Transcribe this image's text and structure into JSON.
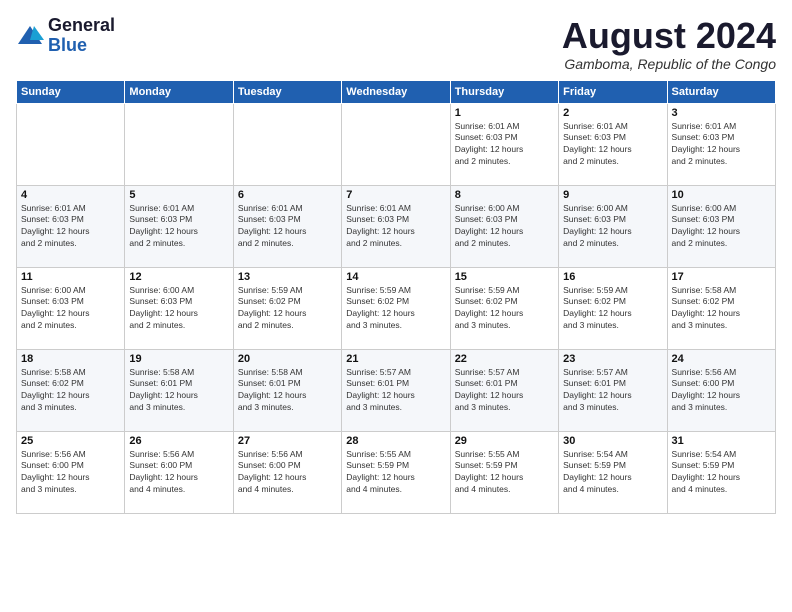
{
  "logo": {
    "general": "General",
    "blue": "Blue"
  },
  "header": {
    "month": "August 2024",
    "location": "Gamboma, Republic of the Congo"
  },
  "weekdays": [
    "Sunday",
    "Monday",
    "Tuesday",
    "Wednesday",
    "Thursday",
    "Friday",
    "Saturday"
  ],
  "weeks": [
    [
      {
        "day": "",
        "sunrise": "",
        "sunset": "",
        "daylight": ""
      },
      {
        "day": "",
        "sunrise": "",
        "sunset": "",
        "daylight": ""
      },
      {
        "day": "",
        "sunrise": "",
        "sunset": "",
        "daylight": ""
      },
      {
        "day": "",
        "sunrise": "",
        "sunset": "",
        "daylight": ""
      },
      {
        "day": "1",
        "sunrise": "6:01 AM",
        "sunset": "6:03 PM",
        "daylight": "12 hours and 2 minutes."
      },
      {
        "day": "2",
        "sunrise": "6:01 AM",
        "sunset": "6:03 PM",
        "daylight": "12 hours and 2 minutes."
      },
      {
        "day": "3",
        "sunrise": "6:01 AM",
        "sunset": "6:03 PM",
        "daylight": "12 hours and 2 minutes."
      }
    ],
    [
      {
        "day": "4",
        "sunrise": "6:01 AM",
        "sunset": "6:03 PM",
        "daylight": "12 hours and 2 minutes."
      },
      {
        "day": "5",
        "sunrise": "6:01 AM",
        "sunset": "6:03 PM",
        "daylight": "12 hours and 2 minutes."
      },
      {
        "day": "6",
        "sunrise": "6:01 AM",
        "sunset": "6:03 PM",
        "daylight": "12 hours and 2 minutes."
      },
      {
        "day": "7",
        "sunrise": "6:01 AM",
        "sunset": "6:03 PM",
        "daylight": "12 hours and 2 minutes."
      },
      {
        "day": "8",
        "sunrise": "6:00 AM",
        "sunset": "6:03 PM",
        "daylight": "12 hours and 2 minutes."
      },
      {
        "day": "9",
        "sunrise": "6:00 AM",
        "sunset": "6:03 PM",
        "daylight": "12 hours and 2 minutes."
      },
      {
        "day": "10",
        "sunrise": "6:00 AM",
        "sunset": "6:03 PM",
        "daylight": "12 hours and 2 minutes."
      }
    ],
    [
      {
        "day": "11",
        "sunrise": "6:00 AM",
        "sunset": "6:03 PM",
        "daylight": "12 hours and 2 minutes."
      },
      {
        "day": "12",
        "sunrise": "6:00 AM",
        "sunset": "6:03 PM",
        "daylight": "12 hours and 2 minutes."
      },
      {
        "day": "13",
        "sunrise": "5:59 AM",
        "sunset": "6:02 PM",
        "daylight": "12 hours and 2 minutes."
      },
      {
        "day": "14",
        "sunrise": "5:59 AM",
        "sunset": "6:02 PM",
        "daylight": "12 hours and 3 minutes."
      },
      {
        "day": "15",
        "sunrise": "5:59 AM",
        "sunset": "6:02 PM",
        "daylight": "12 hours and 3 minutes."
      },
      {
        "day": "16",
        "sunrise": "5:59 AM",
        "sunset": "6:02 PM",
        "daylight": "12 hours and 3 minutes."
      },
      {
        "day": "17",
        "sunrise": "5:58 AM",
        "sunset": "6:02 PM",
        "daylight": "12 hours and 3 minutes."
      }
    ],
    [
      {
        "day": "18",
        "sunrise": "5:58 AM",
        "sunset": "6:02 PM",
        "daylight": "12 hours and 3 minutes."
      },
      {
        "day": "19",
        "sunrise": "5:58 AM",
        "sunset": "6:01 PM",
        "daylight": "12 hours and 3 minutes."
      },
      {
        "day": "20",
        "sunrise": "5:58 AM",
        "sunset": "6:01 PM",
        "daylight": "12 hours and 3 minutes."
      },
      {
        "day": "21",
        "sunrise": "5:57 AM",
        "sunset": "6:01 PM",
        "daylight": "12 hours and 3 minutes."
      },
      {
        "day": "22",
        "sunrise": "5:57 AM",
        "sunset": "6:01 PM",
        "daylight": "12 hours and 3 minutes."
      },
      {
        "day": "23",
        "sunrise": "5:57 AM",
        "sunset": "6:01 PM",
        "daylight": "12 hours and 3 minutes."
      },
      {
        "day": "24",
        "sunrise": "5:56 AM",
        "sunset": "6:00 PM",
        "daylight": "12 hours and 3 minutes."
      }
    ],
    [
      {
        "day": "25",
        "sunrise": "5:56 AM",
        "sunset": "6:00 PM",
        "daylight": "12 hours and 3 minutes."
      },
      {
        "day": "26",
        "sunrise": "5:56 AM",
        "sunset": "6:00 PM",
        "daylight": "12 hours and 4 minutes."
      },
      {
        "day": "27",
        "sunrise": "5:56 AM",
        "sunset": "6:00 PM",
        "daylight": "12 hours and 4 minutes."
      },
      {
        "day": "28",
        "sunrise": "5:55 AM",
        "sunset": "5:59 PM",
        "daylight": "12 hours and 4 minutes."
      },
      {
        "day": "29",
        "sunrise": "5:55 AM",
        "sunset": "5:59 PM",
        "daylight": "12 hours and 4 minutes."
      },
      {
        "day": "30",
        "sunrise": "5:54 AM",
        "sunset": "5:59 PM",
        "daylight": "12 hours and 4 minutes."
      },
      {
        "day": "31",
        "sunrise": "5:54 AM",
        "sunset": "5:59 PM",
        "daylight": "12 hours and 4 minutes."
      }
    ]
  ],
  "labels": {
    "sunrise": "Sunrise:",
    "sunset": "Sunset:",
    "daylight": "Daylight:"
  }
}
